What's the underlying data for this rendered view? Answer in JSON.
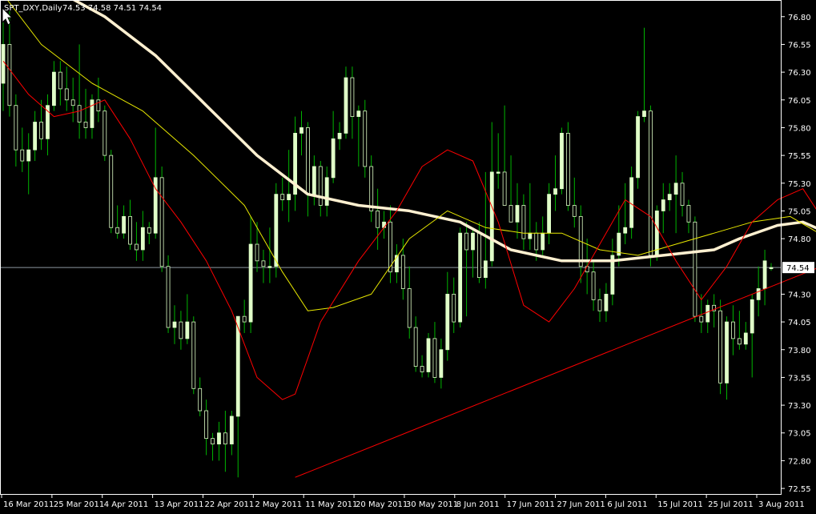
{
  "window": {
    "symbol_caption": "SPT_DXY,Daily",
    "ohlc_caption": "74.53 74.58 74.51 74.54"
  },
  "colors": {
    "background": "#000000",
    "frame": "#ffffff",
    "candle_body": "#e0ffc8",
    "candle_wick": "#00b400",
    "ma_slow": "#fff0d0",
    "ma_mid": "#e8e800",
    "ma_fast": "#ff0000",
    "trendline": "#ff0000",
    "price_line": "#8c96a0"
  },
  "price_label": "74.54",
  "chart_data": {
    "type": "candlestick",
    "ylim": [
      72.5,
      76.95
    ],
    "y_ticks": [
      "76.80",
      "76.55",
      "76.30",
      "76.05",
      "75.80",
      "75.55",
      "75.30",
      "75.05",
      "74.80",
      "74.54",
      "74.30",
      "74.05",
      "73.80",
      "73.55",
      "73.30",
      "73.05",
      "72.80",
      "72.55"
    ],
    "x_labels": [
      "16 Mar 2011",
      "25 Mar 2011",
      "4 Apr 2011",
      "13 Apr 2011",
      "22 Apr 2011",
      "2 May 2011",
      "11 May 2011",
      "20 May 2011",
      "30 May 2011",
      "8 Jun 2011",
      "17 Jun 2011",
      "27 Jun 2011",
      "6 Jul 2011",
      "15 Jul 2011",
      "25 Jul 2011",
      "3 Aug 2011"
    ],
    "bars": [
      {
        "o": 76.2,
        "h": 76.75,
        "l": 75.95,
        "c": 76.55
      },
      {
        "o": 76.55,
        "h": 76.85,
        "l": 75.9,
        "c": 76.0
      },
      {
        "o": 76.0,
        "h": 76.1,
        "l": 75.45,
        "c": 75.6
      },
      {
        "o": 75.6,
        "h": 75.8,
        "l": 75.4,
        "c": 75.5
      },
      {
        "o": 75.5,
        "h": 75.75,
        "l": 75.2,
        "c": 75.6
      },
      {
        "o": 75.6,
        "h": 75.95,
        "l": 75.5,
        "c": 75.85
      },
      {
        "o": 75.85,
        "h": 76.05,
        "l": 75.6,
        "c": 75.7
      },
      {
        "o": 75.7,
        "h": 76.1,
        "l": 75.55,
        "c": 76.0
      },
      {
        "o": 76.0,
        "h": 76.4,
        "l": 75.95,
        "c": 76.3
      },
      {
        "o": 76.3,
        "h": 76.4,
        "l": 76.0,
        "c": 76.15
      },
      {
        "o": 76.15,
        "h": 76.35,
        "l": 75.95,
        "c": 76.05
      },
      {
        "o": 76.05,
        "h": 76.25,
        "l": 75.85,
        "c": 76.0
      },
      {
        "o": 76.0,
        "h": 76.55,
        "l": 75.7,
        "c": 75.85
      },
      {
        "o": 75.85,
        "h": 76.15,
        "l": 75.7,
        "c": 75.8
      },
      {
        "o": 75.8,
        "h": 76.1,
        "l": 75.7,
        "c": 76.05
      },
      {
        "o": 76.05,
        "h": 76.25,
        "l": 75.85,
        "c": 75.95
      },
      {
        "o": 75.95,
        "h": 76.0,
        "l": 75.5,
        "c": 75.55
      },
      {
        "o": 75.55,
        "h": 75.6,
        "l": 74.85,
        "c": 74.9
      },
      {
        "o": 74.9,
        "h": 75.1,
        "l": 74.8,
        "c": 74.85
      },
      {
        "o": 74.85,
        "h": 75.1,
        "l": 74.8,
        "c": 75.0
      },
      {
        "o": 75.0,
        "h": 75.15,
        "l": 74.7,
        "c": 74.75
      },
      {
        "o": 74.75,
        "h": 74.95,
        "l": 74.6,
        "c": 74.7
      },
      {
        "o": 74.7,
        "h": 75.05,
        "l": 74.6,
        "c": 74.9
      },
      {
        "o": 74.9,
        "h": 74.95,
        "l": 74.75,
        "c": 74.85
      },
      {
        "o": 74.85,
        "h": 75.8,
        "l": 74.8,
        "c": 75.35
      },
      {
        "o": 75.35,
        "h": 75.45,
        "l": 74.5,
        "c": 74.55
      },
      {
        "o": 74.55,
        "h": 74.65,
        "l": 73.95,
        "c": 74.0
      },
      {
        "o": 74.0,
        "h": 74.2,
        "l": 73.85,
        "c": 74.05
      },
      {
        "o": 74.05,
        "h": 74.15,
        "l": 73.8,
        "c": 73.9
      },
      {
        "o": 73.9,
        "h": 74.3,
        "l": 73.85,
        "c": 74.05
      },
      {
        "o": 74.05,
        "h": 74.1,
        "l": 73.4,
        "c": 73.45
      },
      {
        "o": 73.45,
        "h": 73.55,
        "l": 73.2,
        "c": 73.25
      },
      {
        "o": 73.25,
        "h": 73.35,
        "l": 72.85,
        "c": 73.0
      },
      {
        "o": 73.0,
        "h": 73.05,
        "l": 72.8,
        "c": 72.95
      },
      {
        "o": 72.95,
        "h": 73.15,
        "l": 72.8,
        "c": 73.05
      },
      {
        "o": 73.05,
        "h": 73.25,
        "l": 72.7,
        "c": 72.95
      },
      {
        "o": 72.95,
        "h": 73.25,
        "l": 72.85,
        "c": 73.2
      },
      {
        "o": 73.2,
        "h": 74.1,
        "l": 72.65,
        "c": 74.1
      },
      {
        "o": 74.1,
        "h": 74.25,
        "l": 73.95,
        "c": 74.05
      },
      {
        "o": 74.05,
        "h": 75.0,
        "l": 73.95,
        "c": 74.75
      },
      {
        "o": 74.75,
        "h": 74.95,
        "l": 74.5,
        "c": 74.6
      },
      {
        "o": 74.6,
        "h": 74.7,
        "l": 74.4,
        "c": 74.55
      },
      {
        "o": 74.55,
        "h": 74.9,
        "l": 74.4,
        "c": 74.55
      },
      {
        "o": 74.55,
        "h": 75.3,
        "l": 74.45,
        "c": 75.2
      },
      {
        "o": 75.2,
        "h": 75.35,
        "l": 75.05,
        "c": 75.15
      },
      {
        "o": 75.15,
        "h": 75.6,
        "l": 74.95,
        "c": 75.2
      },
      {
        "o": 75.2,
        "h": 75.9,
        "l": 75.05,
        "c": 75.75
      },
      {
        "o": 75.75,
        "h": 75.95,
        "l": 75.55,
        "c": 75.8
      },
      {
        "o": 75.8,
        "h": 75.85,
        "l": 75.0,
        "c": 75.2
      },
      {
        "o": 75.2,
        "h": 75.55,
        "l": 75.1,
        "c": 75.45
      },
      {
        "o": 75.45,
        "h": 75.5,
        "l": 75.0,
        "c": 75.1
      },
      {
        "o": 75.1,
        "h": 75.45,
        "l": 75.0,
        "c": 75.35
      },
      {
        "o": 75.35,
        "h": 75.95,
        "l": 75.3,
        "c": 75.7
      },
      {
        "o": 75.7,
        "h": 75.85,
        "l": 75.6,
        "c": 75.75
      },
      {
        "o": 75.75,
        "h": 76.35,
        "l": 75.7,
        "c": 76.25
      },
      {
        "o": 76.25,
        "h": 76.35,
        "l": 75.7,
        "c": 75.9
      },
      {
        "o": 75.9,
        "h": 76.0,
        "l": 75.45,
        "c": 75.95
      },
      {
        "o": 75.95,
        "h": 76.05,
        "l": 75.35,
        "c": 75.45
      },
      {
        "o": 75.45,
        "h": 75.55,
        "l": 74.95,
        "c": 75.05
      },
      {
        "o": 75.05,
        "h": 75.25,
        "l": 74.7,
        "c": 74.9
      },
      {
        "o": 74.9,
        "h": 75.05,
        "l": 74.8,
        "c": 74.95
      },
      {
        "o": 74.95,
        "h": 75.1,
        "l": 74.4,
        "c": 74.5
      },
      {
        "o": 74.5,
        "h": 74.75,
        "l": 74.4,
        "c": 74.65
      },
      {
        "o": 74.65,
        "h": 74.8,
        "l": 74.25,
        "c": 74.35
      },
      {
        "o": 74.35,
        "h": 74.55,
        "l": 73.9,
        "c": 74.0
      },
      {
        "o": 74.0,
        "h": 74.1,
        "l": 73.6,
        "c": 73.65
      },
      {
        "o": 73.65,
        "h": 73.75,
        "l": 73.55,
        "c": 73.6
      },
      {
        "o": 73.6,
        "h": 73.95,
        "l": 73.55,
        "c": 73.9
      },
      {
        "o": 73.9,
        "h": 74.05,
        "l": 73.5,
        "c": 73.55
      },
      {
        "o": 73.55,
        "h": 73.9,
        "l": 73.45,
        "c": 73.8
      },
      {
        "o": 73.8,
        "h": 74.5,
        "l": 73.7,
        "c": 74.3
      },
      {
        "o": 74.3,
        "h": 74.45,
        "l": 73.95,
        "c": 74.05
      },
      {
        "o": 74.05,
        "h": 74.9,
        "l": 74.0,
        "c": 74.85
      },
      {
        "o": 74.85,
        "h": 74.95,
        "l": 74.1,
        "c": 74.7
      },
      {
        "o": 74.7,
        "h": 74.9,
        "l": 74.45,
        "c": 74.85
      },
      {
        "o": 74.85,
        "h": 74.95,
        "l": 74.4,
        "c": 74.45
      },
      {
        "o": 74.45,
        "h": 75.4,
        "l": 74.35,
        "c": 74.6
      },
      {
        "o": 74.6,
        "h": 75.85,
        "l": 74.55,
        "c": 75.4
      },
      {
        "o": 75.4,
        "h": 75.75,
        "l": 75.25,
        "c": 75.4
      },
      {
        "o": 75.4,
        "h": 76.0,
        "l": 75.3,
        "c": 75.1
      },
      {
        "o": 75.1,
        "h": 75.55,
        "l": 74.95,
        "c": 74.95
      },
      {
        "o": 74.95,
        "h": 75.3,
        "l": 74.8,
        "c": 75.1
      },
      {
        "o": 75.1,
        "h": 75.2,
        "l": 74.7,
        "c": 74.8
      },
      {
        "o": 74.8,
        "h": 75.3,
        "l": 74.7,
        "c": 74.85
      },
      {
        "o": 74.85,
        "h": 74.95,
        "l": 74.6,
        "c": 74.7
      },
      {
        "o": 74.7,
        "h": 75.0,
        "l": 74.65,
        "c": 74.85
      },
      {
        "o": 74.85,
        "h": 75.3,
        "l": 74.75,
        "c": 75.2
      },
      {
        "o": 75.2,
        "h": 75.55,
        "l": 75.05,
        "c": 75.25
      },
      {
        "o": 75.25,
        "h": 75.8,
        "l": 75.2,
        "c": 75.75
      },
      {
        "o": 75.75,
        "h": 75.85,
        "l": 75.05,
        "c": 75.1
      },
      {
        "o": 75.1,
        "h": 75.35,
        "l": 74.9,
        "c": 75.0
      },
      {
        "o": 75.0,
        "h": 75.1,
        "l": 74.4,
        "c": 74.55
      },
      {
        "o": 74.55,
        "h": 74.8,
        "l": 74.3,
        "c": 74.5
      },
      {
        "o": 74.5,
        "h": 74.6,
        "l": 74.15,
        "c": 74.25
      },
      {
        "o": 74.25,
        "h": 74.35,
        "l": 74.05,
        "c": 74.15
      },
      {
        "o": 74.15,
        "h": 74.4,
        "l": 74.05,
        "c": 74.3
      },
      {
        "o": 74.3,
        "h": 74.8,
        "l": 74.2,
        "c": 74.65
      },
      {
        "o": 74.65,
        "h": 75.1,
        "l": 74.55,
        "c": 74.85
      },
      {
        "o": 74.85,
        "h": 75.3,
        "l": 74.75,
        "c": 74.9
      },
      {
        "o": 74.9,
        "h": 75.45,
        "l": 74.8,
        "c": 75.35
      },
      {
        "o": 75.35,
        "h": 75.95,
        "l": 75.25,
        "c": 75.9
      },
      {
        "o": 75.9,
        "h": 76.7,
        "l": 75.85,
        "c": 75.95
      },
      {
        "o": 75.95,
        "h": 76.0,
        "l": 74.55,
        "c": 74.65
      },
      {
        "o": 74.65,
        "h": 75.1,
        "l": 74.6,
        "c": 75.05
      },
      {
        "o": 75.05,
        "h": 75.3,
        "l": 74.85,
        "c": 75.15
      },
      {
        "o": 75.15,
        "h": 75.3,
        "l": 75.05,
        "c": 75.2
      },
      {
        "o": 75.2,
        "h": 75.55,
        "l": 74.85,
        "c": 75.3
      },
      {
        "o": 75.3,
        "h": 75.4,
        "l": 75.0,
        "c": 75.1
      },
      {
        "o": 75.1,
        "h": 75.15,
        "l": 74.85,
        "c": 74.95
      },
      {
        "o": 74.95,
        "h": 75.0,
        "l": 74.05,
        "c": 74.1
      },
      {
        "o": 74.1,
        "h": 74.3,
        "l": 73.95,
        "c": 74.05
      },
      {
        "o": 74.05,
        "h": 74.25,
        "l": 73.95,
        "c": 74.2
      },
      {
        "o": 74.2,
        "h": 74.3,
        "l": 74.0,
        "c": 74.15
      },
      {
        "o": 74.15,
        "h": 74.25,
        "l": 73.4,
        "c": 73.5
      },
      {
        "o": 73.5,
        "h": 74.1,
        "l": 73.35,
        "c": 74.05
      },
      {
        "o": 74.05,
        "h": 74.2,
        "l": 73.75,
        "c": 73.9
      },
      {
        "o": 73.9,
        "h": 74.15,
        "l": 73.8,
        "c": 73.85
      },
      {
        "o": 73.85,
        "h": 74.05,
        "l": 73.8,
        "c": 73.95
      },
      {
        "o": 73.95,
        "h": 74.3,
        "l": 73.55,
        "c": 74.25
      },
      {
        "o": 74.25,
        "h": 74.55,
        "l": 74.1,
        "c": 74.35
      },
      {
        "o": 74.35,
        "h": 74.7,
        "l": 74.2,
        "c": 74.6
      },
      {
        "o": 74.53,
        "h": 74.58,
        "l": 74.51,
        "c": 74.54
      }
    ],
    "ma_slow": [
      [
        0,
        77.2
      ],
      [
        8,
        77.05
      ],
      [
        16,
        76.8
      ],
      [
        24,
        76.45
      ],
      [
        32,
        76.0
      ],
      [
        40,
        75.55
      ],
      [
        48,
        75.2
      ],
      [
        56,
        75.1
      ],
      [
        64,
        75.05
      ],
      [
        72,
        74.95
      ],
      [
        80,
        74.7
      ],
      [
        88,
        74.6
      ],
      [
        96,
        74.6
      ],
      [
        104,
        74.65
      ],
      [
        112,
        74.7
      ],
      [
        116,
        74.8
      ],
      [
        122,
        74.92
      ],
      [
        126,
        74.95
      ],
      [
        130,
        74.85
      ],
      [
        135,
        74.75
      ],
      [
        140,
        74.62
      ]
    ],
    "ma_mid": [
      [
        0,
        77.0
      ],
      [
        6,
        76.55
      ],
      [
        14,
        76.2
      ],
      [
        22,
        75.95
      ],
      [
        30,
        75.55
      ],
      [
        38,
        75.1
      ],
      [
        44,
        74.5
      ],
      [
        48,
        74.15
      ],
      [
        52,
        74.18
      ],
      [
        58,
        74.3
      ],
      [
        64,
        74.8
      ],
      [
        70,
        75.05
      ],
      [
        76,
        74.9
      ],
      [
        82,
        74.85
      ],
      [
        88,
        74.85
      ],
      [
        94,
        74.7
      ],
      [
        100,
        74.65
      ],
      [
        106,
        74.75
      ],
      [
        112,
        74.85
      ],
      [
        118,
        74.95
      ],
      [
        124,
        75.0
      ],
      [
        130,
        74.8
      ],
      [
        136,
        74.65
      ],
      [
        140,
        74.65
      ]
    ],
    "ma_fast": [
      [
        0,
        76.4
      ],
      [
        4,
        76.1
      ],
      [
        8,
        75.9
      ],
      [
        12,
        75.95
      ],
      [
        16,
        76.05
      ],
      [
        20,
        75.7
      ],
      [
        24,
        75.25
      ],
      [
        28,
        74.95
      ],
      [
        32,
        74.6
      ],
      [
        36,
        74.15
      ],
      [
        40,
        73.55
      ],
      [
        44,
        73.35
      ],
      [
        46,
        73.4
      ],
      [
        50,
        74.05
      ],
      [
        56,
        74.6
      ],
      [
        62,
        75.05
      ],
      [
        66,
        75.45
      ],
      [
        70,
        75.6
      ],
      [
        74,
        75.5
      ],
      [
        78,
        74.95
      ],
      [
        82,
        74.2
      ],
      [
        86,
        74.05
      ],
      [
        90,
        74.35
      ],
      [
        94,
        74.75
      ],
      [
        98,
        75.15
      ],
      [
        102,
        75.0
      ],
      [
        106,
        74.6
      ],
      [
        110,
        74.25
      ],
      [
        114,
        74.55
      ],
      [
        118,
        74.95
      ],
      [
        122,
        75.15
      ],
      [
        126,
        75.25
      ],
      [
        130,
        74.9
      ],
      [
        134,
        74.5
      ],
      [
        137,
        74.05
      ],
      [
        140,
        74.05
      ]
    ],
    "trendline": [
      [
        46,
        72.65
      ],
      [
        142,
        74.85
      ]
    ]
  }
}
